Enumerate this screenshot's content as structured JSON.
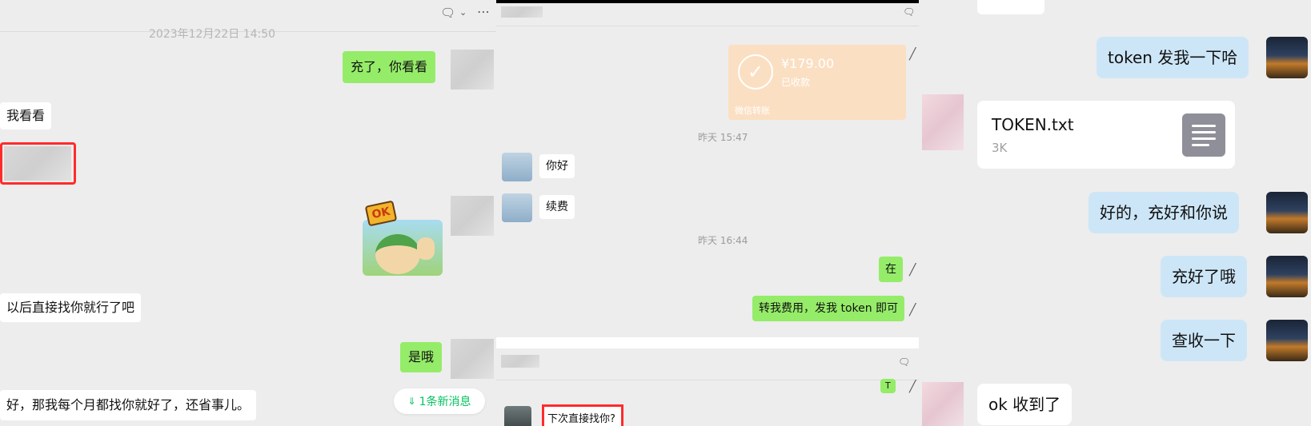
{
  "panel1": {
    "timestamp": "2023年12月22日 14:50",
    "messages": [
      "充了，你看看",
      "我看看",
      "以后直接找你就行了吧",
      "是哦",
      "好，那我每个月都找你就好了，还省事儿。"
    ],
    "sticker_text": "OK",
    "new_msg_badge": "1条新消息",
    "icons": [
      "chat-icon",
      "chevron-down-icon",
      "more-icon"
    ]
  },
  "panel2": {
    "transfer": {
      "amount": "¥179.00",
      "status": "已收款",
      "label": "微信转账"
    },
    "time1": "昨天 15:47",
    "time2": "昨天 16:44",
    "messages": [
      "你好",
      "续费",
      "在",
      "转我费用，发我 token 即可"
    ],
    "bottom_message": "下次直接找你?",
    "bottom_left_text": "T"
  },
  "panel3": {
    "messages": [
      "token 发我一下哈",
      "好的，充好和你说",
      "充好了哦",
      "查收一下",
      "ok 收到了"
    ],
    "file": {
      "name": "TOKEN.txt",
      "size": "3K"
    }
  },
  "colors": {
    "green_bubble": "#95ec69",
    "blue_bubble": "#cde6f7",
    "highlight_red": "#ff2b2b",
    "new_msg_green": "#07c160"
  }
}
